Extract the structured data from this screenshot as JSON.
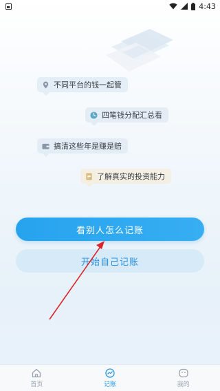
{
  "status_bar": {
    "time": "4:43"
  },
  "feature_bubbles": [
    {
      "label": "不同平台的钱一起管",
      "icon": "location-pin-icon"
    },
    {
      "label": "四笔钱分配汇总看",
      "icon": "pie-clock-icon"
    },
    {
      "label": "搞清这些年是赚是赔",
      "icon": "wallet-icon"
    },
    {
      "label": "了解真实的投资能力",
      "icon": "document-icon"
    }
  ],
  "buttons": {
    "primary": "看别人怎么记账",
    "secondary": "开始自己记账"
  },
  "tabbar": {
    "tabs": [
      {
        "label": "首页",
        "icon": "home-icon"
      },
      {
        "label": "记账",
        "icon": "chart-icon"
      },
      {
        "label": "我的",
        "icon": "smiley-icon"
      }
    ],
    "active_index": 1
  },
  "colors": {
    "accent": "#2b96e6",
    "primary_button": "#2fa8f0",
    "secondary_button": "#d7eaf8",
    "annotation_arrow": "#d9262a"
  }
}
